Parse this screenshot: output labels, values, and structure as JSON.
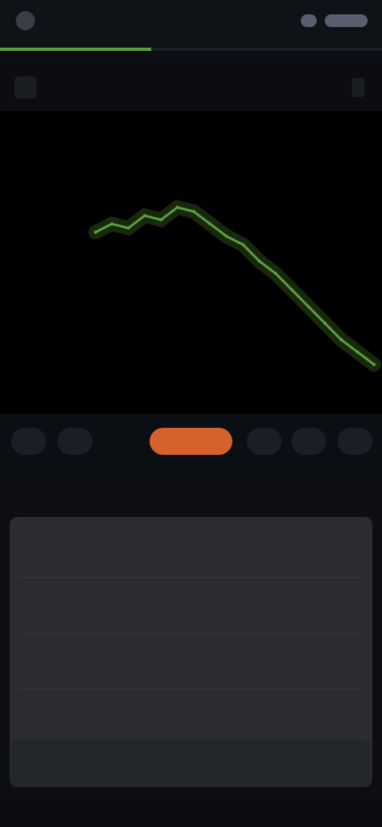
{
  "status_bar": {
    "time": "",
    "icons": [
      "app-icon",
      "signal-icon",
      "battery-icon"
    ]
  },
  "header": {
    "title": "",
    "back_icon": "back-icon",
    "menu_icon": "menu-icon"
  },
  "timeframes": [
    "",
    "",
    "",
    "",
    "",
    ""
  ],
  "panel": {
    "rows": [
      {
        "label": "",
        "value": "",
        "right": ""
      },
      {
        "label": "",
        "value": "",
        "right": ""
      },
      {
        "label": "",
        "value": "",
        "right": ""
      },
      {
        "label": "",
        "value": "",
        "right": ""
      }
    ]
  },
  "footer": {
    "action_label": ""
  },
  "colors": {
    "accent": "#d5622c",
    "up": "#5aa03c",
    "link": "#4a6fa8",
    "background": "#0c0e13"
  },
  "chart_data": {
    "type": "line",
    "title": "",
    "xlabel": "",
    "ylabel": "",
    "series": [
      {
        "values": [
          100,
          102,
          101,
          104,
          103,
          106,
          105,
          102,
          99,
          97,
          93,
          90,
          86,
          82,
          78,
          74,
          71,
          68
        ]
      }
    ],
    "ylim": [
      60,
      110
    ],
    "grid": false,
    "legend": "none"
  }
}
